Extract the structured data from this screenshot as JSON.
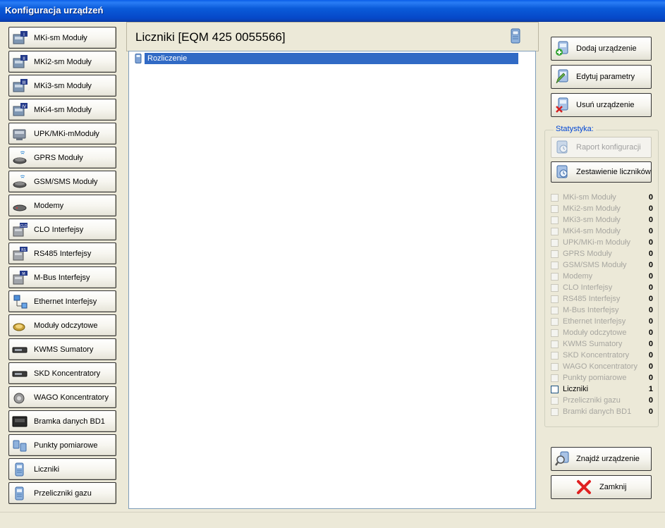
{
  "window": {
    "title": "Konfiguracja urządzeń"
  },
  "nav": [
    {
      "label": "MKi-sm Moduły",
      "icon": "module-i-icon",
      "badge": "I"
    },
    {
      "label": "MKi2-sm Moduły",
      "icon": "module-ii-icon",
      "badge": "II"
    },
    {
      "label": "MKi3-sm Moduły",
      "icon": "module-iii-icon",
      "badge": "III"
    },
    {
      "label": "MKi4-sm Moduły",
      "icon": "module-iv-icon",
      "badge": "IV"
    },
    {
      "label": "UPK/MKi-mModuły",
      "icon": "upk-module-icon"
    },
    {
      "label": "GPRS Moduły",
      "icon": "gprs-module-icon"
    },
    {
      "label": "GSM/SMS Moduły",
      "icon": "gsm-module-icon"
    },
    {
      "label": "Modemy",
      "icon": "modem-icon"
    },
    {
      "label": "CLO Interfejsy",
      "icon": "clo-interface-icon",
      "badge": "CLO"
    },
    {
      "label": "RS485 Interfejsy",
      "icon": "rs485-interface-icon",
      "badge": "RS"
    },
    {
      "label": "M-Bus Interfejsy",
      "icon": "mbus-interface-icon",
      "badge": "M"
    },
    {
      "label": "Ethernet Interfejsy",
      "icon": "ethernet-interface-icon"
    },
    {
      "label": "Moduły odczytowe",
      "icon": "reading-module-icon"
    },
    {
      "label": "KWMS Sumatory",
      "icon": "kwms-summator-icon"
    },
    {
      "label": "SKD Koncentratory",
      "icon": "skd-concentrator-icon"
    },
    {
      "label": "WAGO Koncentratory",
      "icon": "wago-concentrator-icon"
    },
    {
      "label": "Bramka danych BD1",
      "icon": "data-gateway-icon"
    },
    {
      "label": "Punkty pomiarowe",
      "icon": "measurement-point-icon"
    },
    {
      "label": "Liczniki",
      "icon": "meter-icon"
    },
    {
      "label": "Przeliczniki gazu",
      "icon": "gas-converter-icon"
    }
  ],
  "center": {
    "title": "Liczniki  [EQM 425 0055566]",
    "tree": [
      {
        "label": "Rozliczenie",
        "selected": true
      }
    ]
  },
  "actions": {
    "add": "Dodaj urządzenie",
    "edit": "Edytuj parametry",
    "remove": "Usuń urządzenie",
    "find": "Znajdź urządzenie",
    "close": "Zamknij"
  },
  "stats": {
    "group_title": "Statystyka:",
    "report": "Raport konfiguracji",
    "summary": "Zestawienie liczników",
    "items": [
      {
        "label": "MKi-sm Moduły",
        "count": "0",
        "enabled": false
      },
      {
        "label": "MKi2-sm Moduły",
        "count": "0",
        "enabled": false
      },
      {
        "label": "MKi3-sm Moduły",
        "count": "0",
        "enabled": false
      },
      {
        "label": "MKi4-sm Moduły",
        "count": "0",
        "enabled": false
      },
      {
        "label": "UPK/MKi-m Moduły",
        "count": "0",
        "enabled": false
      },
      {
        "label": "GPRS Moduły",
        "count": "0",
        "enabled": false
      },
      {
        "label": "GSM/SMS Moduły",
        "count": "0",
        "enabled": false
      },
      {
        "label": "Modemy",
        "count": "0",
        "enabled": false
      },
      {
        "label": "CLO Interfejsy",
        "count": "0",
        "enabled": false
      },
      {
        "label": "RS485 Interfejsy",
        "count": "0",
        "enabled": false
      },
      {
        "label": "M-Bus Interfejsy",
        "count": "0",
        "enabled": false
      },
      {
        "label": "Ethernet Interfejsy",
        "count": "0",
        "enabled": false
      },
      {
        "label": "Moduły odczytowe",
        "count": "0",
        "enabled": false
      },
      {
        "label": "KWMS Sumatory",
        "count": "0",
        "enabled": false
      },
      {
        "label": "SKD Koncentratory",
        "count": "0",
        "enabled": false
      },
      {
        "label": "WAGO Koncentratory",
        "count": "0",
        "enabled": false
      },
      {
        "label": "Punkty pomiarowe",
        "count": "0",
        "enabled": false
      },
      {
        "label": "Liczniki",
        "count": "1",
        "enabled": true
      },
      {
        "label": "Przeliczniki gazu",
        "count": "0",
        "enabled": false
      },
      {
        "label": "Bramki danych BD1",
        "count": "0",
        "enabled": false
      }
    ]
  },
  "colors": {
    "titlebar": "#0a5bd9",
    "selection": "#316ac5",
    "group_title": "#0046d5",
    "window_bg": "#ece9d8"
  }
}
